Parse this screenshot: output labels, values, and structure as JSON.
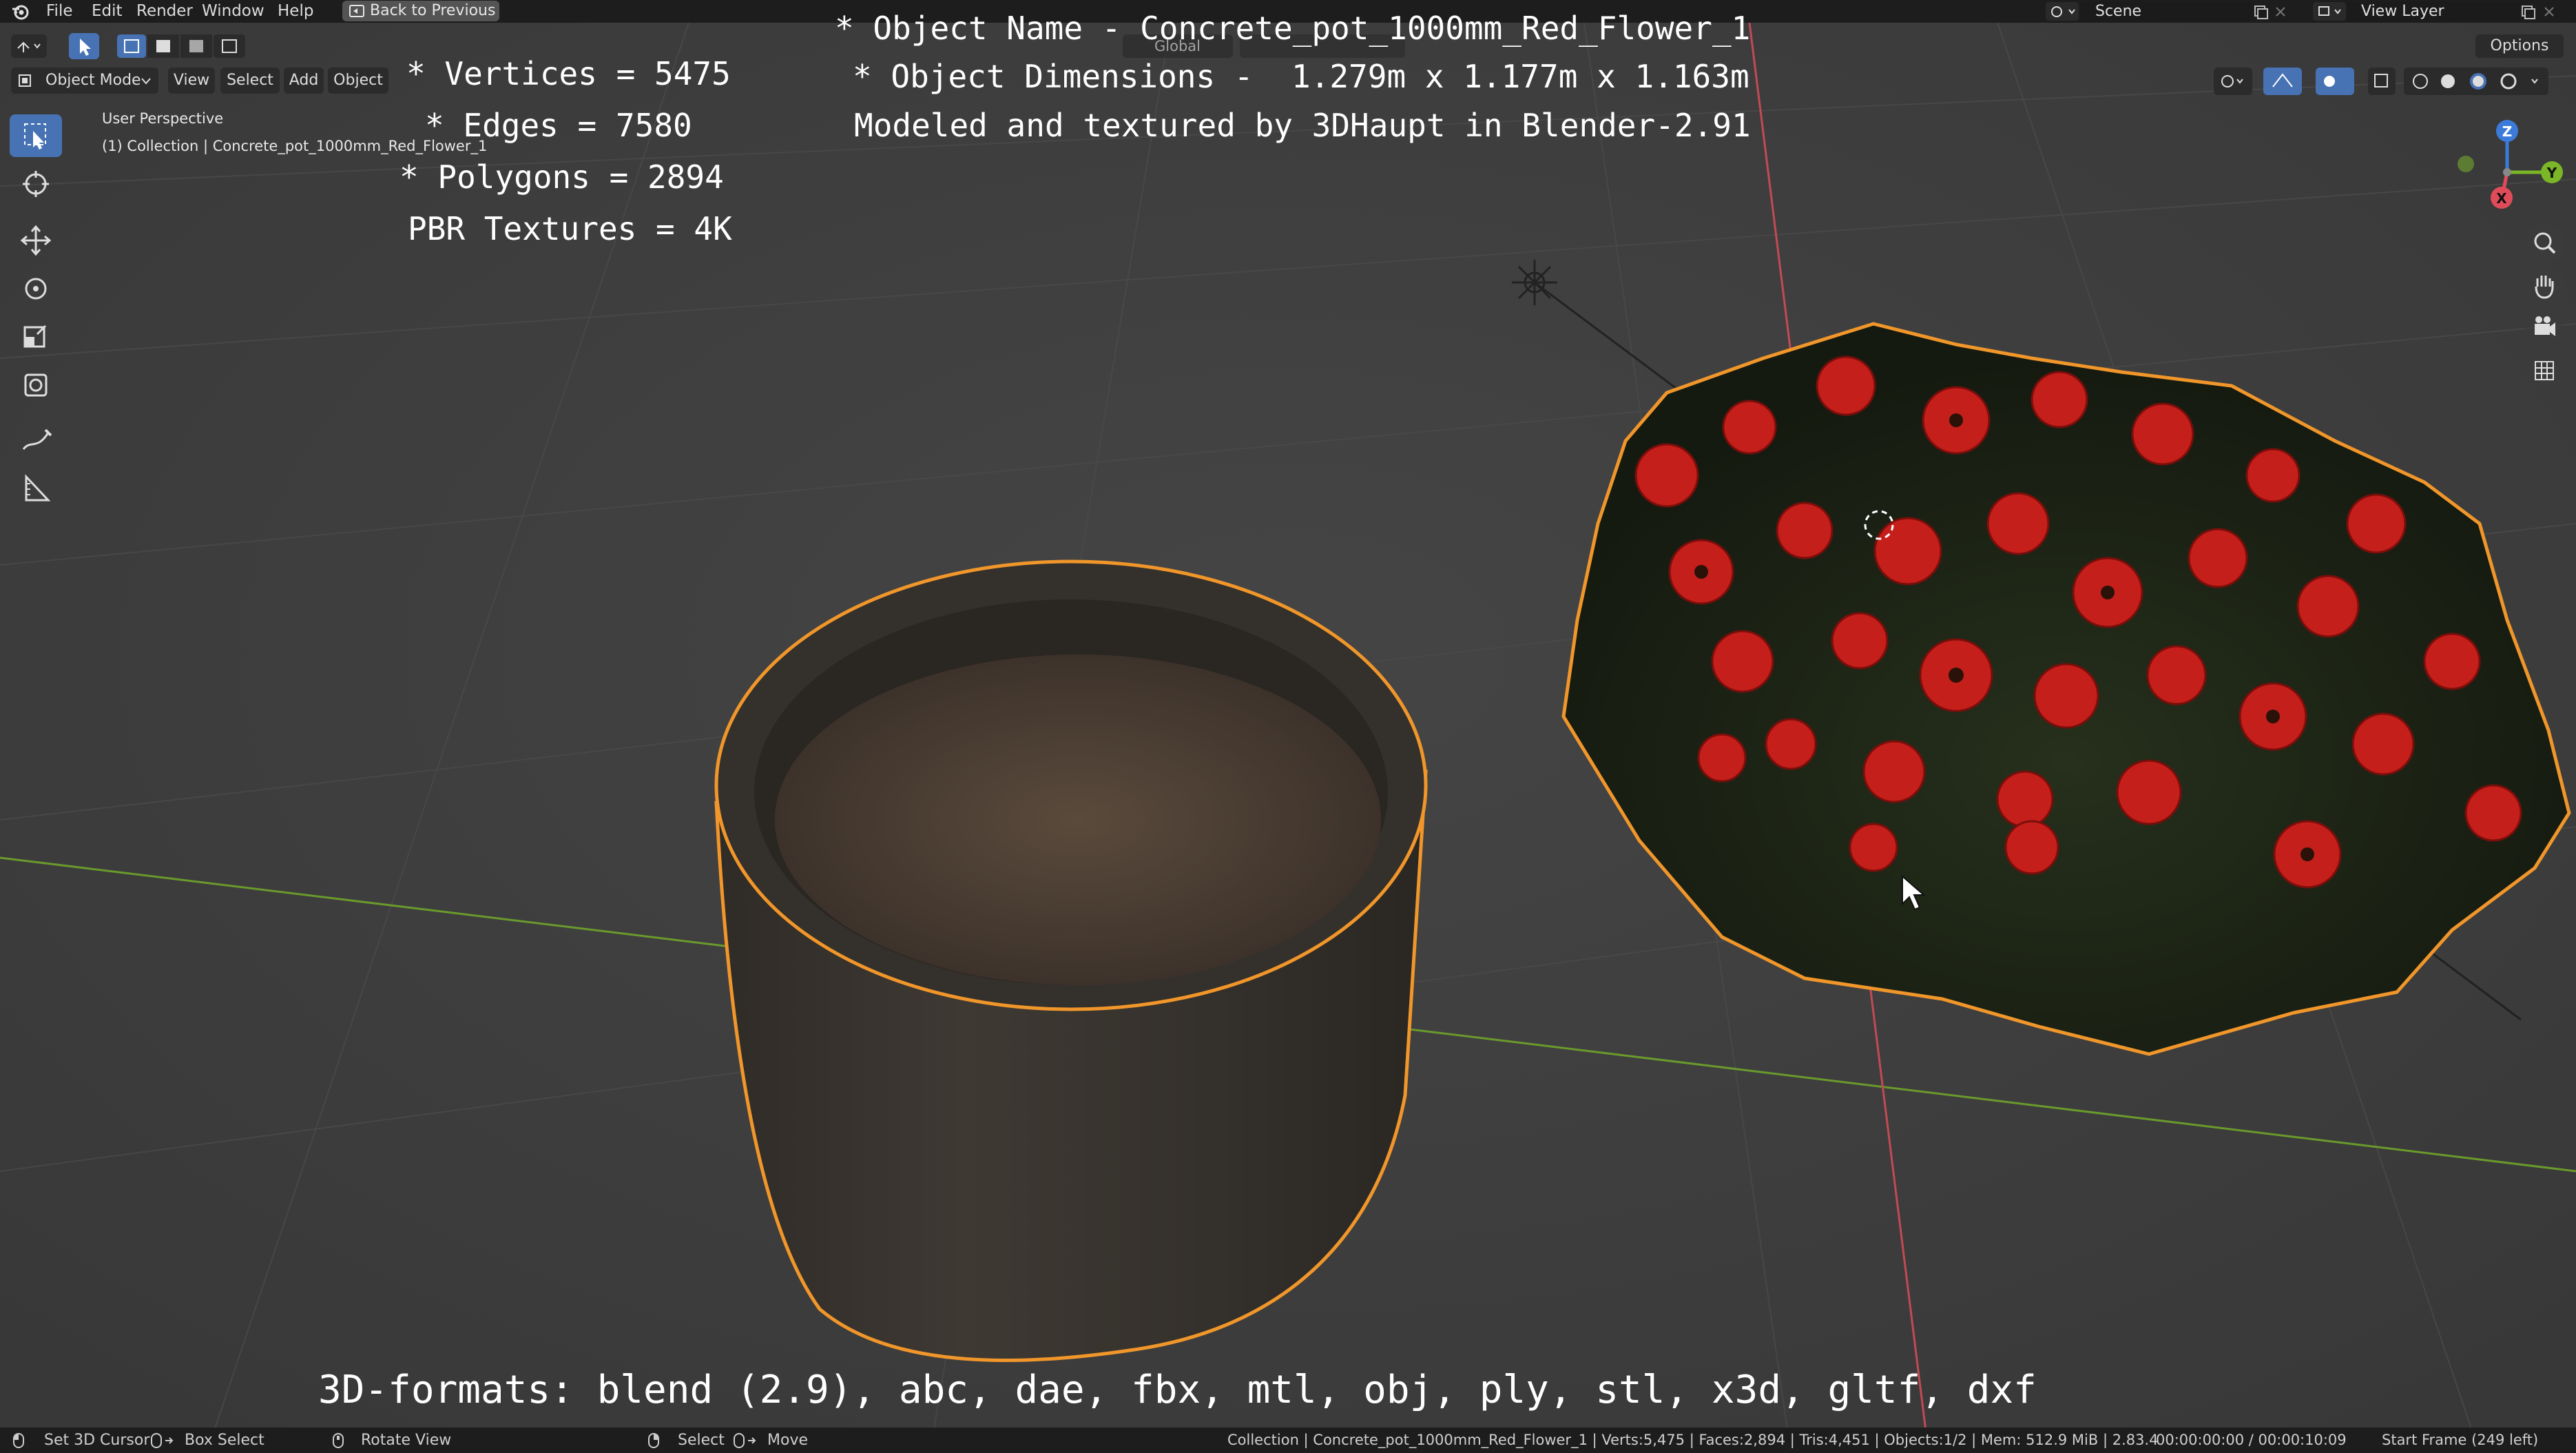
{
  "top_menu": {
    "items": [
      "File",
      "Edit",
      "Render",
      "Window",
      "Help"
    ],
    "back_button": "Back to Previous",
    "scene": "Scene",
    "view_layer": "View Layer"
  },
  "header": {
    "mode": "Object Mode",
    "menu": [
      "View",
      "Select",
      "Add",
      "Object"
    ],
    "transform_orientation": "Global",
    "options": "Options"
  },
  "viewport": {
    "perspective": "User Perspective",
    "collection": "(1) Collection | Concrete_pot_1000mm_Red_Flower_1"
  },
  "overlay": {
    "vertices": "* Vertices = 5475",
    "edges": "* Edges = 7580",
    "polygons": "* Polygons = 2894",
    "textures": "PBR Textures = 4K",
    "object_name": "* Object Name - Concrete_pot_1000mm_Red_Flower_1",
    "dimensions": "* Object Dimensions -  1.279m x 1.177m x 1.163m",
    "credit": "Modeled and textured by 3DHaupt in Blender-2.91",
    "formats": "3D-formats: blend (2.9), abc, dae, fbx, mtl, obj, ply, stl, x3d, gltf, dxf"
  },
  "gizmo": {
    "z": "Z",
    "y": "Y",
    "x": "X"
  },
  "status": {
    "cursor": "Set 3D Cursor",
    "box_select": "Box Select",
    "rotate": "Rotate View",
    "select": "Select",
    "move": "Move",
    "stats": "Collection | Concrete_pot_1000mm_Red_Flower_1 | Verts:5,475 | Faces:2,894 | Tris:4,451 | Objects:1/2 | Mem: 512.9 MiB | 2.83.4",
    "time": "00:00:00:00 / 00:00:10:09",
    "frame": "Start Frame (249 left)"
  },
  "colors": {
    "selection_outline": "#f0962a",
    "active_tool": "#4772b3",
    "x_axis": "#e04b5a",
    "y_axis": "#7bb627",
    "z_axis": "#3c7bd9"
  }
}
